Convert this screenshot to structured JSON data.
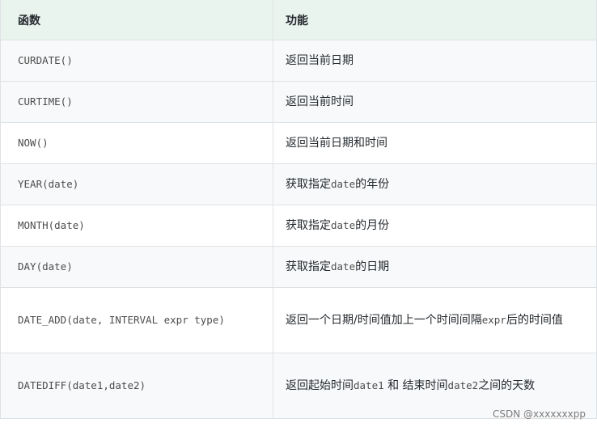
{
  "table": {
    "headers": [
      "函数",
      "功能"
    ],
    "rows": [
      {
        "func": "CURDATE()",
        "desc": [
          "返回当前日期"
        ]
      },
      {
        "func": "CURTIME()",
        "desc": [
          "返回当前时间"
        ]
      },
      {
        "func": "NOW()",
        "desc": [
          "返回当前日期和时间"
        ]
      },
      {
        "func": "YEAR(date)",
        "desc": [
          "获取指定",
          "date",
          "的年份"
        ]
      },
      {
        "func": "MONTH(date)",
        "desc": [
          "获取指定",
          "date",
          "的月份"
        ]
      },
      {
        "func": "DAY(date)",
        "desc": [
          "获取指定",
          "date",
          "的日期"
        ]
      },
      {
        "func": "DATE_ADD(date, INTERVAL expr type)",
        "desc": [
          "返回一个日期/时间值加上一个时间间隔",
          "expr",
          "后的时间值"
        ]
      },
      {
        "func": "DATEDIFF(date1,date2)",
        "desc": [
          "返回起始时间",
          "date1",
          " 和 结束时间",
          "date2",
          "之间的天数"
        ]
      }
    ]
  },
  "watermark": "CSDN @xxxxxxxpp",
  "colors": {
    "header_bg": "#eaf4ee",
    "alt_row_bg": "#f8f9fa",
    "border": "#dfe2e5"
  }
}
